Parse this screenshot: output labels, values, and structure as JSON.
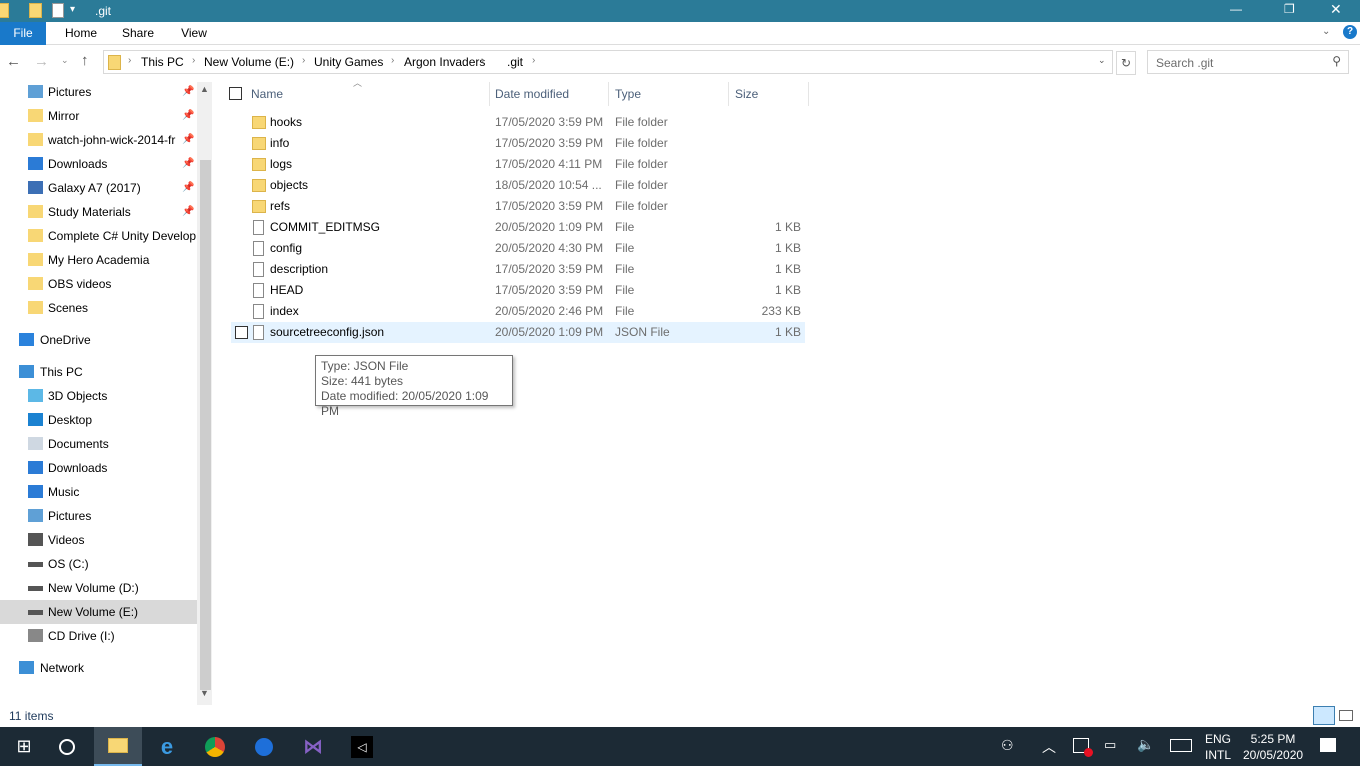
{
  "window": {
    "title": ".git",
    "controls": [
      "minimize",
      "maximize",
      "close"
    ]
  },
  "ribbon": {
    "tabs": [
      "File",
      "Home",
      "Share",
      "View"
    ]
  },
  "address": {
    "crumbs": [
      "This PC",
      "New Volume (E:)",
      "Unity Games",
      "Argon Invaders",
      ".git"
    ],
    "search_placeholder": "Search .git"
  },
  "sidebar": {
    "items": [
      {
        "label": "Pictures",
        "icon": "pictures-icon",
        "pinned": true
      },
      {
        "label": "Mirror",
        "icon": "folder-icon",
        "pinned": true
      },
      {
        "label": "watch-john-wick-2014-fr",
        "icon": "folder-icon",
        "pinned": true
      },
      {
        "label": "Downloads",
        "icon": "download-icon",
        "pinned": true
      },
      {
        "label": "Galaxy A7 (2017)",
        "icon": "phone-icon",
        "pinned": true
      },
      {
        "label": "Study Materials",
        "icon": "folder-icon",
        "pinned": true
      },
      {
        "label": "Complete C# Unity Develop",
        "icon": "folder-icon",
        "pinned": false
      },
      {
        "label": "My Hero Academia",
        "icon": "folder-icon",
        "pinned": false
      },
      {
        "label": "OBS videos",
        "icon": "folder-icon",
        "pinned": false
      },
      {
        "label": "Scenes",
        "icon": "folder-icon",
        "pinned": false
      },
      {
        "label": "OneDrive",
        "icon": "cloud-icon",
        "top": true
      },
      {
        "label": "This PC",
        "icon": "computer-icon",
        "top": true
      },
      {
        "label": "3D Objects",
        "icon": "cube-icon"
      },
      {
        "label": "Desktop",
        "icon": "desktop-icon"
      },
      {
        "label": "Documents",
        "icon": "documents-icon"
      },
      {
        "label": "Downloads",
        "icon": "download-icon"
      },
      {
        "label": "Music",
        "icon": "music-icon"
      },
      {
        "label": "Pictures",
        "icon": "pictures-icon"
      },
      {
        "label": "Videos",
        "icon": "videos-icon"
      },
      {
        "label": "OS (C:)",
        "icon": "drive-icon"
      },
      {
        "label": "New Volume (D:)",
        "icon": "drive-icon"
      },
      {
        "label": "New Volume (E:)",
        "icon": "drive-icon",
        "selected": true
      },
      {
        "label": "CD Drive (I:)",
        "icon": "cd-icon"
      },
      {
        "label": "Network",
        "icon": "network-icon",
        "top": true
      }
    ]
  },
  "columns": {
    "name": "Name",
    "date": "Date modified",
    "type": "Type",
    "size": "Size"
  },
  "files": [
    {
      "name": "hooks",
      "date": "17/05/2020 3:59 PM",
      "type": "File folder",
      "size": "",
      "folder": true
    },
    {
      "name": "info",
      "date": "17/05/2020 3:59 PM",
      "type": "File folder",
      "size": "",
      "folder": true
    },
    {
      "name": "logs",
      "date": "17/05/2020 4:11 PM",
      "type": "File folder",
      "size": "",
      "folder": true
    },
    {
      "name": "objects",
      "date": "18/05/2020 10:54 ...",
      "type": "File folder",
      "size": "",
      "folder": true
    },
    {
      "name": "refs",
      "date": "17/05/2020 3:59 PM",
      "type": "File folder",
      "size": "",
      "folder": true
    },
    {
      "name": "COMMIT_EDITMSG",
      "date": "20/05/2020 1:09 PM",
      "type": "File",
      "size": "1 KB"
    },
    {
      "name": "config",
      "date": "20/05/2020 4:30 PM",
      "type": "File",
      "size": "1 KB"
    },
    {
      "name": "description",
      "date": "17/05/2020 3:59 PM",
      "type": "File",
      "size": "1 KB"
    },
    {
      "name": "HEAD",
      "date": "17/05/2020 3:59 PM",
      "type": "File",
      "size": "1 KB"
    },
    {
      "name": "index",
      "date": "20/05/2020 2:46 PM",
      "type": "File",
      "size": "233 KB"
    },
    {
      "name": "sourcetreeconfig.json",
      "date": "20/05/2020 1:09 PM",
      "type": "JSON File",
      "size": "1 KB",
      "hover": true
    }
  ],
  "tooltip": {
    "type": "Type: JSON File",
    "size": "Size: 441 bytes",
    "date": "Date modified: 20/05/2020 1:09 PM"
  },
  "status": {
    "count": "11 items"
  },
  "taskbar": {
    "lang1": "ENG",
    "lang2": "INTL",
    "time": "5:25 PM",
    "date": "20/05/2020"
  }
}
